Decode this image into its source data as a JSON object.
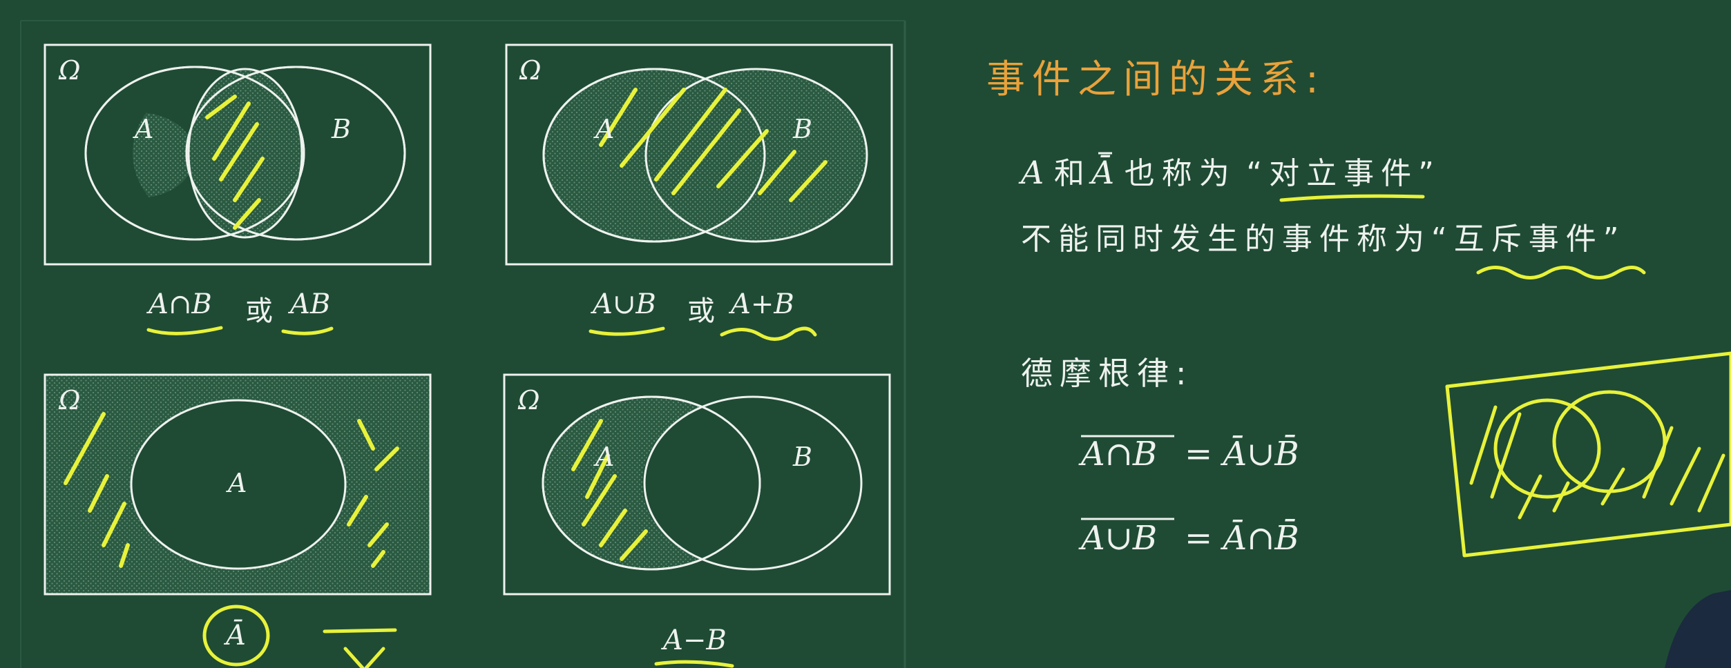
{
  "diagrams": [
    {
      "omega": "Ω",
      "set_a": "A",
      "set_b": "B",
      "caption_a": "A∩B",
      "caption_or": "或",
      "caption_b": "AB"
    },
    {
      "omega": "Ω",
      "set_a": "A",
      "set_b": "B",
      "caption_a": "A∪B",
      "caption_or": "或",
      "caption_b": "A+B"
    },
    {
      "omega": "Ω",
      "set_a": "A",
      "caption_a": "Ā"
    },
    {
      "omega": "Ω",
      "set_a": "A",
      "set_b": "B",
      "caption_a": "A−B"
    }
  ],
  "right": {
    "title": "事件之间的关系:",
    "line1_a": "A",
    "line1_mid": "和",
    "line1_abar": "Ā",
    "line1_text": "也称为",
    "line1_quote": "“对立事件”",
    "line2_text": "不能同时发生的事件称为",
    "line2_quote": "“互斥事件”",
    "demorgan": "德摩根律:",
    "formula1_lhs": "A∩B",
    "formula1_rhs": "= Ā∪B̄",
    "formula2_lhs": "A∪B",
    "formula2_rhs": "= Ā∩B̄"
  },
  "colors": {
    "board": "#1f4b34",
    "chalk": "#eef2ee",
    "title": "#e9a23b",
    "marker": "#e8f23a"
  }
}
